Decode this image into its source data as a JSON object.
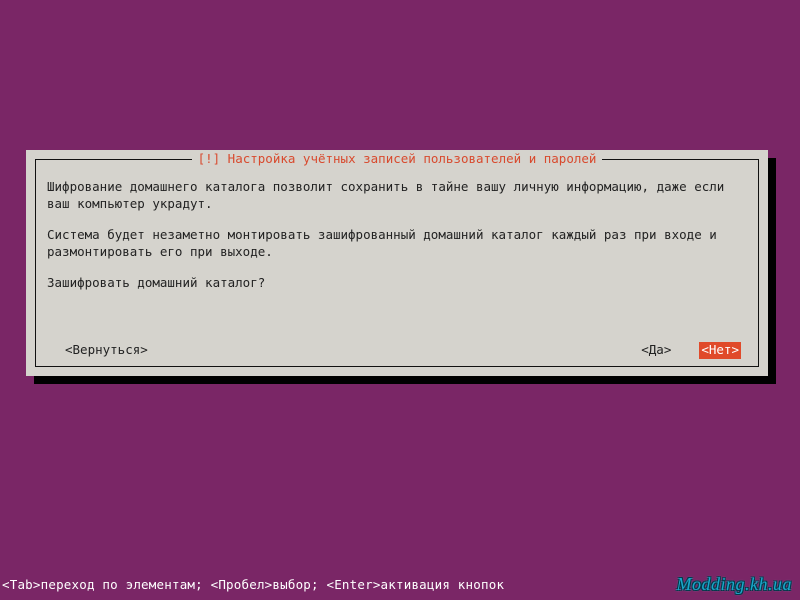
{
  "dialog": {
    "title": "[!] Настройка учётных записей пользователей и паролей",
    "paragraph1": "Шифрование домашнего каталога позволит сохранить в тайне вашу личную информацию, даже если ваш компьютер украдут.",
    "paragraph2": "Система будет незаметно монтировать зашифрованный домашний каталог каждый раз при входе и размонтировать его при выходе.",
    "question": "Зашифровать домашний каталог?",
    "back_label": "<Вернуться>",
    "yes_label": "<Да>",
    "no_label": "<Нет>"
  },
  "footer": {
    "help_text": "<Tab>переход по элементам; <Пробел>выбор; <Enter>активация кнопок"
  },
  "watermark": {
    "text": "Modding.kh.ua"
  },
  "colors": {
    "background": "#7a2666",
    "dialog_bg": "#d5d3cd",
    "title_fg": "#d84a2e",
    "selected_bg": "#e04a2a",
    "selected_fg": "#ffffff",
    "text_fg": "#222222"
  }
}
